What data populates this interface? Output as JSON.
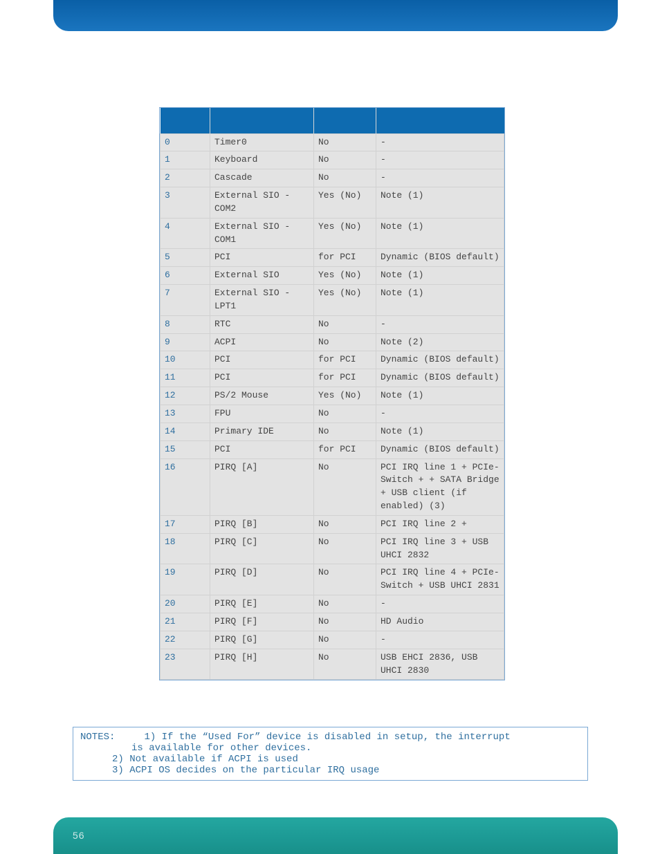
{
  "table": {
    "headers": [
      "",
      "",
      "",
      ""
    ],
    "rows": [
      {
        "n": "0",
        "dev": "Timer0",
        "avail": "No",
        "used": "-"
      },
      {
        "n": "1",
        "dev": "Keyboard",
        "avail": "No",
        "used": "-"
      },
      {
        "n": "2",
        "dev": "Cascade",
        "avail": "No",
        "used": "-"
      },
      {
        "n": "3",
        "dev": "External SIO - COM2",
        "avail": "Yes (No)",
        "used": "Note (1)"
      },
      {
        "n": "4",
        "dev": "External SIO - COM1",
        "avail": "Yes (No)",
        "used": "Note (1)"
      },
      {
        "n": "5",
        "dev": "PCI",
        "avail": "for PCI",
        "used": "Dynamic (BIOS default)"
      },
      {
        "n": "6",
        "dev": "External SIO",
        "avail": "Yes (No)",
        "used": "Note (1)"
      },
      {
        "n": "7",
        "dev": "External SIO - LPT1",
        "avail": "Yes (No)",
        "used": "Note (1)"
      },
      {
        "n": "8",
        "dev": "RTC",
        "avail": "No",
        "used": "-"
      },
      {
        "n": "9",
        "dev": "ACPI",
        "avail": "No",
        "used": "Note (2)"
      },
      {
        "n": "10",
        "dev": "PCI",
        "avail": "for PCI",
        "used": "Dynamic (BIOS default)"
      },
      {
        "n": "11",
        "dev": "PCI",
        "avail": "for PCI",
        "used": "Dynamic (BIOS default)"
      },
      {
        "n": "12",
        "dev": "PS/2 Mouse",
        "avail": "Yes (No)",
        "used": "Note (1)"
      },
      {
        "n": "13",
        "dev": "FPU",
        "avail": "No",
        "used": "-"
      },
      {
        "n": "14",
        "dev": "Primary IDE",
        "avail": "No",
        "used": "Note (1)"
      },
      {
        "n": "15",
        "dev": "PCI",
        "avail": "for PCI",
        "used": "Dynamic (BIOS default)"
      },
      {
        "n": "16",
        "dev": "PIRQ [A]",
        "avail": "No",
        "used": "PCI IRQ line 1 + PCIe- Switch + + SATA Bridge + USB client (if enabled) (3)"
      },
      {
        "n": "17",
        "dev": "PIRQ [B]",
        "avail": "No",
        "used": "PCI IRQ line 2 +"
      },
      {
        "n": "18",
        "dev": "PIRQ [C]",
        "avail": "No",
        "used": "PCI IRQ line 3 + USB UHCI 2832"
      },
      {
        "n": "19",
        "dev": "PIRQ [D]",
        "avail": "No",
        "used": "PCI IRQ line 4 + PCIe- Switch + USB UHCI 2831"
      },
      {
        "n": "20",
        "dev": "PIRQ [E]",
        "avail": "No",
        "used": "-"
      },
      {
        "n": "21",
        "dev": "PIRQ [F]",
        "avail": "No",
        "used": " HD Audio"
      },
      {
        "n": "22",
        "dev": "PIRQ [G]",
        "avail": "No",
        "used": "-"
      },
      {
        "n": "23",
        "dev": "PIRQ [H]",
        "avail": "No",
        "used": "USB EHCI 2836, USB UHCI 2830"
      }
    ]
  },
  "notes": {
    "label": "NOTES:",
    "l1a": "1) If the “Used For” device is disabled in setup, the interrupt",
    "l1b": "is available for other devices.",
    "l2": "2) Not available if ACPI is used",
    "l3": "3) ACPI OS decides on the particular IRQ usage"
  },
  "page_number": "56"
}
